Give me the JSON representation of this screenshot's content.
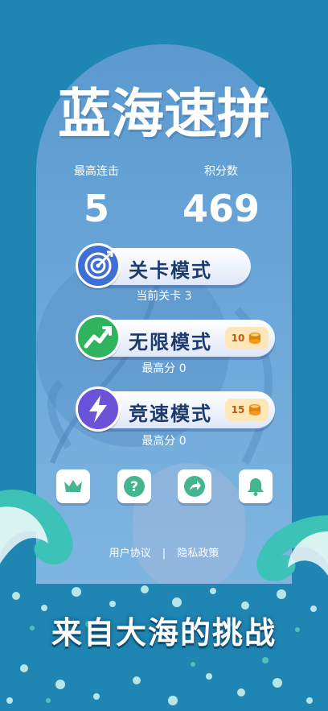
{
  "title": "蓝海速拼",
  "stats": {
    "combo_label": "最高连击",
    "combo_value": "5",
    "score_label": "积分数",
    "score_value": "469"
  },
  "modes": [
    {
      "label": "关卡模式",
      "icon": "target-icon",
      "sub": "当前关卡 3"
    },
    {
      "label": "无限模式",
      "icon": "trend-up-icon",
      "cost": "10",
      "sub": "最高分 0"
    },
    {
      "label": "竞速模式",
      "icon": "lightning-icon",
      "cost": "15",
      "sub": "最高分 0"
    }
  ],
  "icon_buttons": [
    "crown-icon",
    "help-icon",
    "share-icon",
    "bell-icon"
  ],
  "links": {
    "user_agreement": "用户协议",
    "separator": "|",
    "privacy": "隐私政策"
  },
  "banner": "来自大海的挑战",
  "colors": {
    "background": "#1f86b4",
    "panel": "#6aa6d8",
    "button_text": "#1d3a6e",
    "coin": "#f39a1c",
    "icon_green": "#45b58f"
  }
}
